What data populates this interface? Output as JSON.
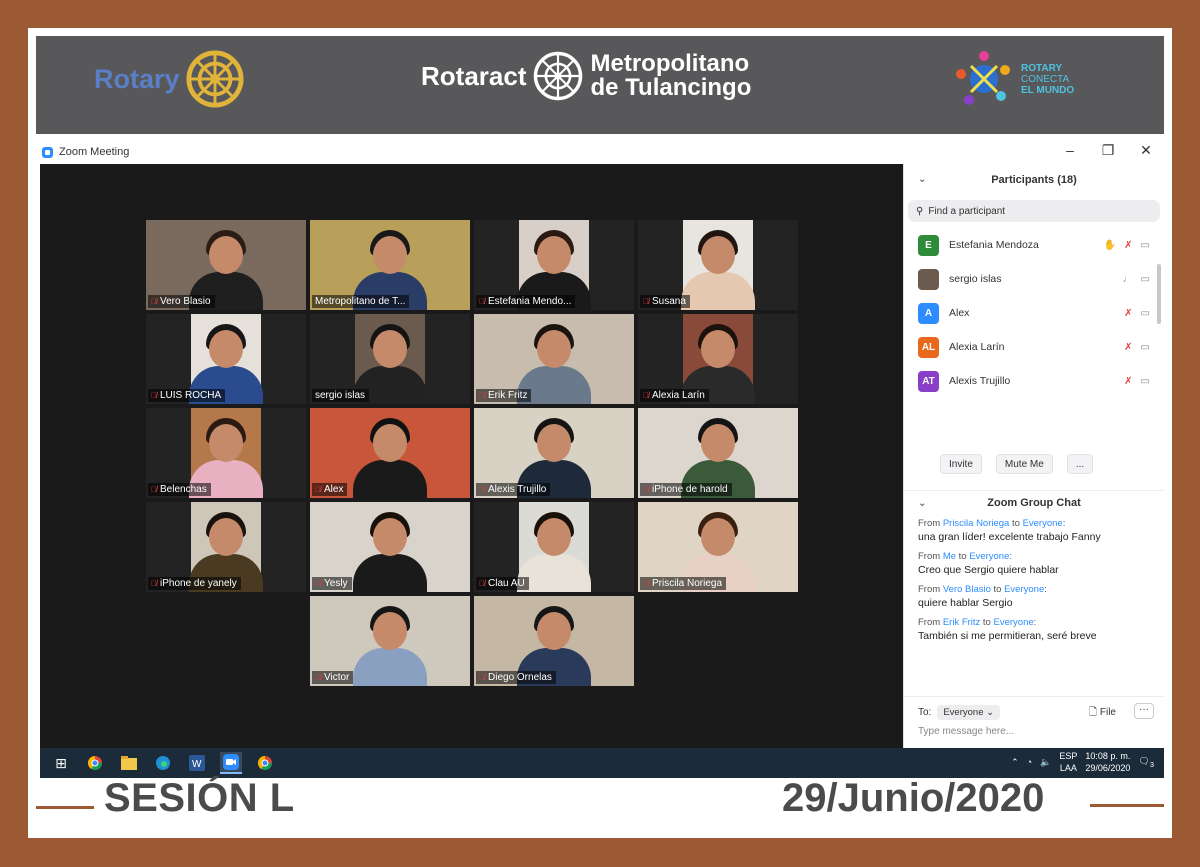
{
  "banner": {
    "rotary": "Rotary",
    "rotaract": "Rotaract",
    "club_line1": "Metropolitano",
    "club_line2": "de Tulancingo",
    "conecta_line1": "ROTARY",
    "conecta_line2": "CONECTA",
    "conecta_line3": "EL MUNDO"
  },
  "window": {
    "title": "Zoom Meeting",
    "controls": [
      "–",
      "❐",
      "✕"
    ]
  },
  "tiles": [
    {
      "name": "Vero Blasio",
      "muted": true,
      "bg": "#7a6a5e",
      "body": "#1f1f1f",
      "hair": "#2a1c14"
    },
    {
      "name": "Metropolitano de T...",
      "muted": false,
      "bg": "#b8a05a",
      "body": "#2a3d66",
      "hair": "#191919",
      "active": true
    },
    {
      "name": "Estefania Mendo...",
      "muted": true,
      "bg": "#d8d0c8",
      "body": "#1a1a1a",
      "hair": "#2b1a10"
    },
    {
      "name": "Susana",
      "muted": true,
      "bg": "#e8e4e0",
      "body": "#e4c8b0",
      "hair": "#221510"
    },
    {
      "name": "LUIS ROCHA",
      "muted": true,
      "bg": "#e6e0da",
      "body": "#2a4c8e",
      "hair": "#161616"
    },
    {
      "name": "sergio islas",
      "muted": false,
      "bg": "#6b5a4e",
      "body": "#222222",
      "hair": "#141414"
    },
    {
      "name": "Erik Fritz",
      "muted": true,
      "bg": "#c8bcae",
      "body": "#6a7a8c",
      "hair": "#1a1410"
    },
    {
      "name": "Alexia Larín",
      "muted": true,
      "bg": "#8a4a3a",
      "body": "#2a2a2a",
      "hair": "#1b120c"
    },
    {
      "name": "Belenchas",
      "muted": true,
      "bg": "#b4784a",
      "body": "#e8b0c0",
      "hair": "#2a1a12"
    },
    {
      "name": "Alex",
      "muted": true,
      "bg": "#c8563a",
      "body": "#1a1a1a",
      "hair": "#111111"
    },
    {
      "name": "Alexis Trujillo",
      "muted": true,
      "bg": "#d8d2c4",
      "body": "#1e2a3a",
      "hair": "#141414"
    },
    {
      "name": "iPhone de harold",
      "muted": true,
      "bg": "#dcd6ce",
      "body": "#3a5a3a",
      "hair": "#141414"
    },
    {
      "name": "iPhone de yanely",
      "muted": true,
      "bg": "#cfc6ba",
      "body": "#4a3a22",
      "hair": "#1a120c"
    },
    {
      "name": "Yesly",
      "muted": true,
      "bg": "#d8d4cc",
      "body": "#1a1a1a",
      "hair": "#1a100a"
    },
    {
      "name": "Clau AU",
      "muted": true,
      "bg": "#dcdad4",
      "body": "#e8e2d8",
      "hair": "#1a100a"
    },
    {
      "name": "Priscila Noriega",
      "muted": true,
      "bg": "#e0d4c4",
      "body": "#e8d0c4",
      "hair": "#3a2010"
    },
    {
      "name": "Victor",
      "muted": true,
      "bg": "#cfc8bc",
      "body": "#8aa0c0",
      "hair": "#161616"
    },
    {
      "name": "Diego Ornelas",
      "muted": true,
      "bg": "#c4b8a4",
      "body": "#2a3a5a",
      "hair": "#161616"
    }
  ],
  "participants": {
    "title": "Participants (18)",
    "search_placeholder": "Find a participant",
    "list": [
      {
        "initials": "E",
        "name": "Estefania Mendoza",
        "color": "#2e8b3a",
        "mic": "muted",
        "hand": true
      },
      {
        "initials": "",
        "name": "sergio islas",
        "color": "#6b5a4e",
        "mic": "on",
        "hand": false
      },
      {
        "initials": "A",
        "name": "Alex",
        "color": "#2d8cff",
        "mic": "muted",
        "hand": false
      },
      {
        "initials": "AL",
        "name": "Alexia Larín",
        "color": "#e8681c",
        "mic": "muted",
        "hand": false
      },
      {
        "initials": "AT",
        "name": "Alexis Trujillo",
        "color": "#8a3fc8",
        "mic": "muted",
        "hand": false
      }
    ],
    "invite": "Invite",
    "mute_me": "Mute Me",
    "more": "..."
  },
  "chat": {
    "title": "Zoom Group Chat",
    "messages": [
      {
        "from_word": "From",
        "sender": "Priscila Noriega",
        "to_word": "to",
        "recipient": "Everyone",
        "text": "una gran líder! excelente trabajo Fanny"
      },
      {
        "from_word": "From",
        "sender": "Me",
        "to_word": "to",
        "recipient": "Everyone",
        "text": "Creo que Sergio quiere hablar"
      },
      {
        "from_word": "From",
        "sender": "Vero Blasio",
        "to_word": "to",
        "recipient": "Everyone",
        "text": "quiere hablar Sergio"
      },
      {
        "from_word": "From",
        "sender": "Erik Fritz",
        "to_word": "to",
        "recipient": "Everyone",
        "text": "También si me permitieran, seré breve"
      }
    ],
    "to_label": "To:",
    "to_value": "Everyone",
    "file_label": "File",
    "more": "···",
    "type_placeholder": "Type message here..."
  },
  "taskbar": {
    "lang_top": "ESP",
    "lang_bottom": "LAA",
    "time": "10:08 p. m.",
    "date": "29/06/2020",
    "notif_count": "3"
  },
  "footer": {
    "session": "SESIÓN L",
    "date": "29/Junio/2020"
  }
}
